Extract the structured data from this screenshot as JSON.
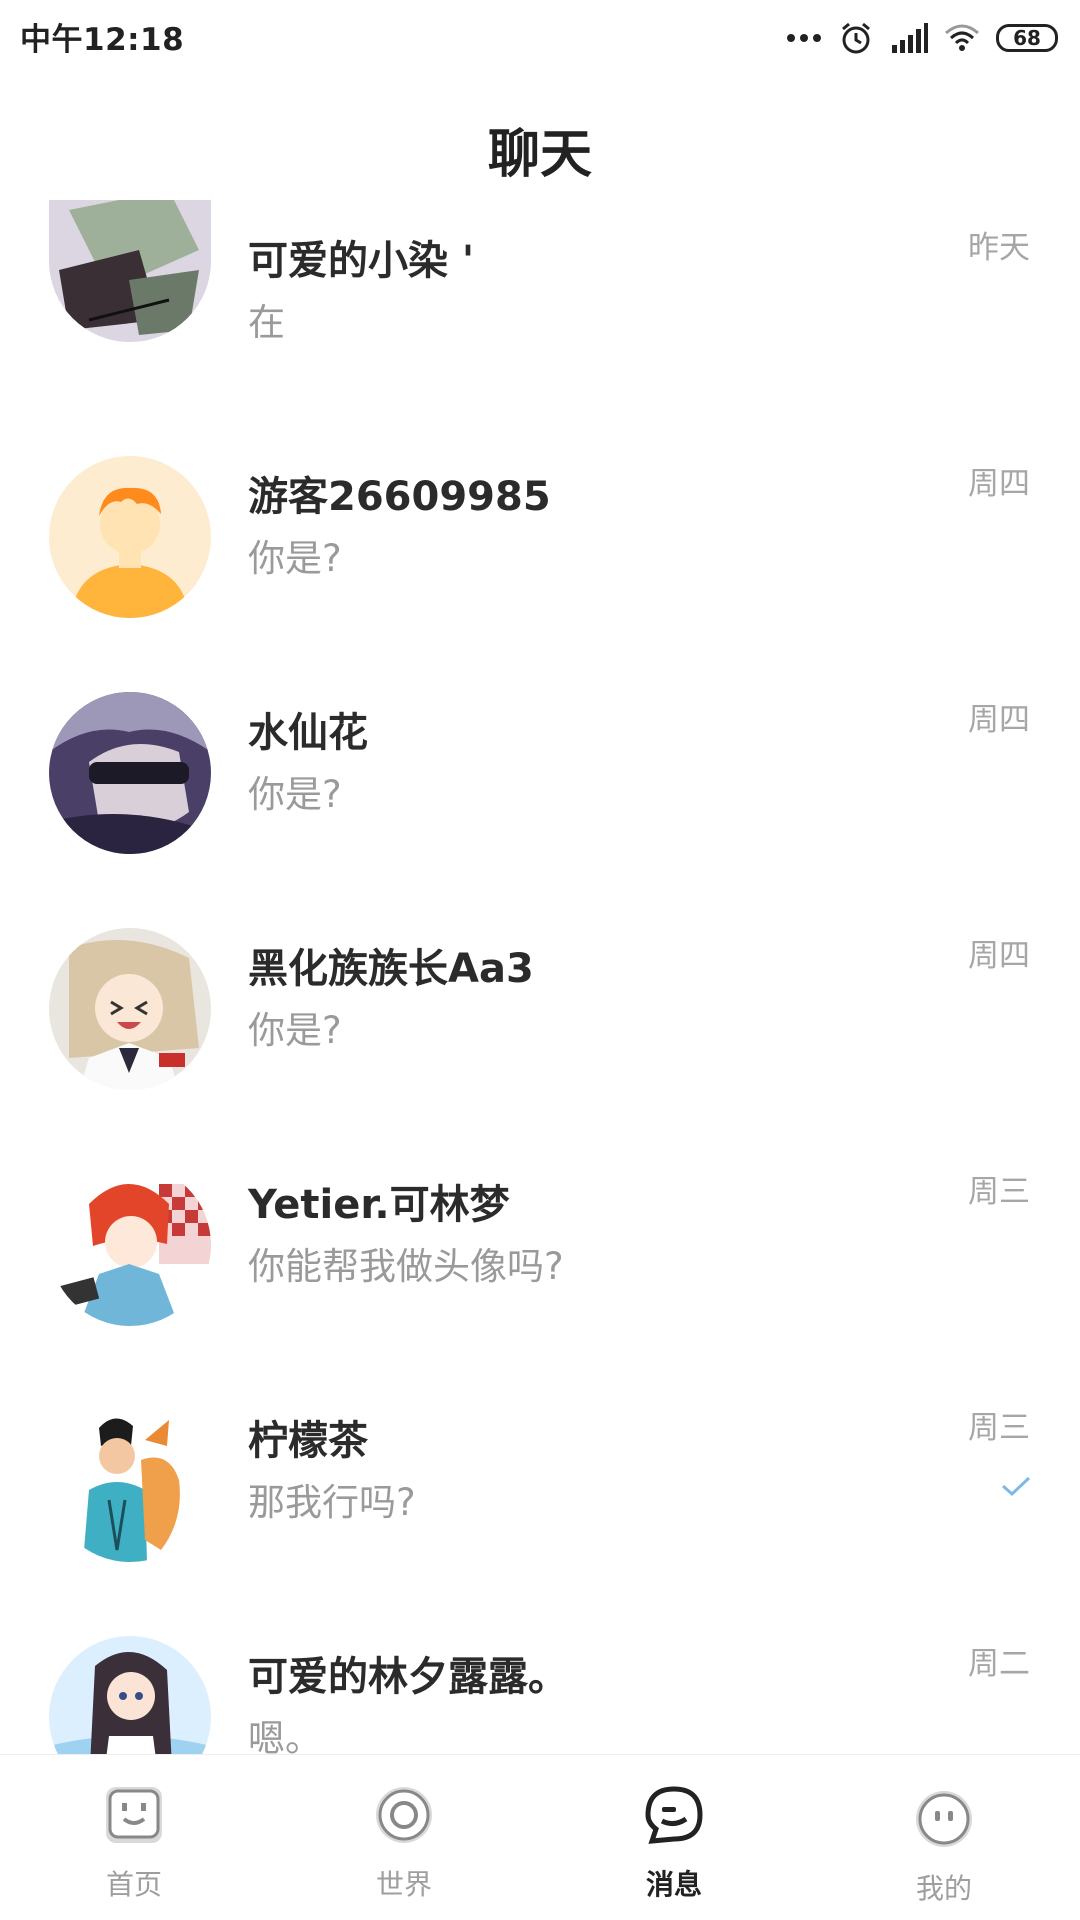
{
  "status_bar": {
    "time": "中午12:18",
    "battery": "68"
  },
  "header": {
    "title": "聊天"
  },
  "chats": [
    {
      "name": "可爱的小染 '",
      "preview": "在",
      "time": "昨天"
    },
    {
      "name": "游客26609985",
      "preview": "你是?",
      "time": "周四"
    },
    {
      "name": "水仙花",
      "preview": "你是?",
      "time": "周四"
    },
    {
      "name": "黑化族族长Aa3",
      "preview": "你是?",
      "time": "周四"
    },
    {
      "name": "Yetier.可林梦",
      "preview": "你能帮我做头像吗?",
      "time": "周三"
    },
    {
      "name": "柠檬茶",
      "preview": "那我行吗?",
      "time": "周三",
      "read": true
    },
    {
      "name": "可爱的林夕露露。",
      "preview": "嗯。",
      "time": "周二"
    }
  ],
  "bottom_nav": {
    "items": [
      {
        "label": "首页",
        "icon": "home-icon"
      },
      {
        "label": "世界",
        "icon": "world-icon"
      },
      {
        "label": "消息",
        "icon": "message-icon",
        "active": true
      },
      {
        "label": "我的",
        "icon": "profile-icon"
      }
    ]
  },
  "colors": {
    "accent_check": "#7cb9e8",
    "text_primary": "#222222",
    "text_secondary": "#9a9a9a"
  }
}
